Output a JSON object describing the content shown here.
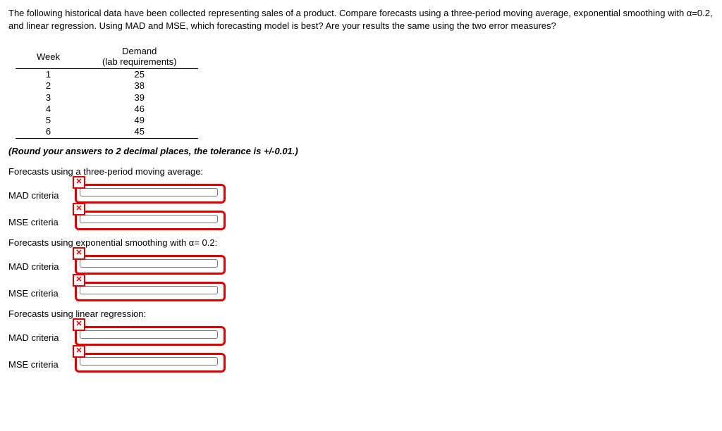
{
  "problem_text": "The following historical data have been collected representing sales of a product. Compare forecasts using a three-period moving average, exponential smoothing with α=0.2, and linear regression. Using MAD and MSE, which forecasting model is best? Are your results the same using the two error measures?",
  "table": {
    "headers": {
      "week": "Week",
      "demand_line1": "Demand",
      "demand_line2": "(lab requirements)"
    },
    "rows": [
      {
        "week": "1",
        "demand": "25"
      },
      {
        "week": "2",
        "demand": "38"
      },
      {
        "week": "3",
        "demand": "39"
      },
      {
        "week": "4",
        "demand": "46"
      },
      {
        "week": "5",
        "demand": "49"
      },
      {
        "week": "6",
        "demand": "45"
      }
    ]
  },
  "instruction": "(Round your answers to 2 decimal places, the tolerance is +/-0.01.)",
  "sections": {
    "ma": {
      "label": "Forecasts using a three-period moving average:"
    },
    "es": {
      "label": "Forecasts using exponential smoothing with α= 0.2:"
    },
    "lr": {
      "label": "Forecasts using linear regression:"
    }
  },
  "criteria": {
    "mad": "MAD criteria",
    "mse": "MSE criteria"
  },
  "wrong_symbol": "✕",
  "values": {
    "ma_mad": "",
    "ma_mse": "",
    "es_mad": "",
    "es_mse": "",
    "lr_mad": "",
    "lr_mse": ""
  }
}
